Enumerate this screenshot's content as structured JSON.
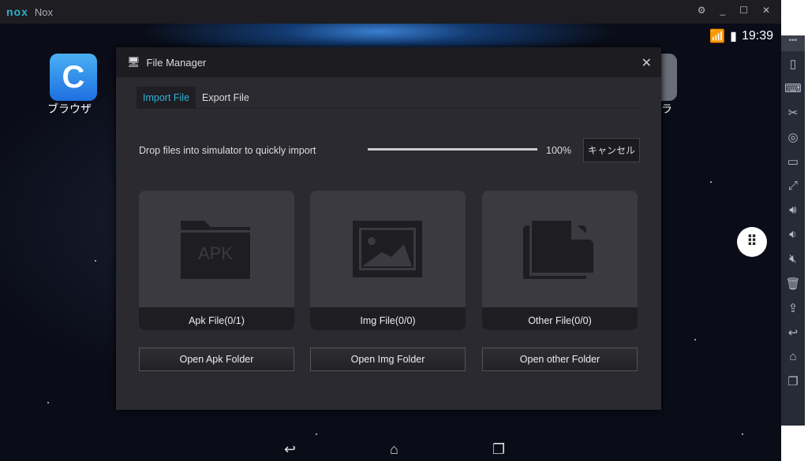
{
  "window": {
    "logo": "nox",
    "title": "Nox",
    "buttons": [
      "settings-icon",
      "minimize-icon",
      "maximize-icon",
      "close-icon"
    ]
  },
  "status": {
    "time": "19:39"
  },
  "home": {
    "apps": [
      {
        "label": "ブラウザ"
      },
      {
        "label": "ラ"
      }
    ]
  },
  "dialog": {
    "title": "File Manager",
    "close": "✕",
    "tabs": [
      {
        "label": "Import File",
        "active": true
      },
      {
        "label": "Export File",
        "active": false
      }
    ],
    "drop_text": "Drop files into simulator to quickly import",
    "progress": 100,
    "progress_label": "100%",
    "cancel": "キャンセル",
    "cards": [
      {
        "label": "Apk File(0/1)",
        "icon": "apk-folder-icon",
        "icon_text": "APK",
        "button": "Open Apk Folder"
      },
      {
        "label": "Img File(0/0)",
        "icon": "image-icon",
        "button": "Open Img Folder"
      },
      {
        "label": "Other File(0/0)",
        "icon": "documents-icon",
        "button": "Open other Folder"
      }
    ]
  },
  "sidebar": {
    "more": "•••",
    "items": [
      "shake-icon",
      "keyboard-icon",
      "screenshot-icon",
      "location-icon",
      "screen-icon",
      "fullscreen-icon",
      "volume-up-icon",
      "volume-down-icon",
      "mute-icon",
      "uninstall-icon",
      "install-apk-icon",
      "back-icon",
      "home-icon",
      "recent-icon"
    ]
  },
  "colors": {
    "accent": "#2fb0d8",
    "dialog_bg": "#2a2a30",
    "titlebar": "#1e1d22"
  }
}
